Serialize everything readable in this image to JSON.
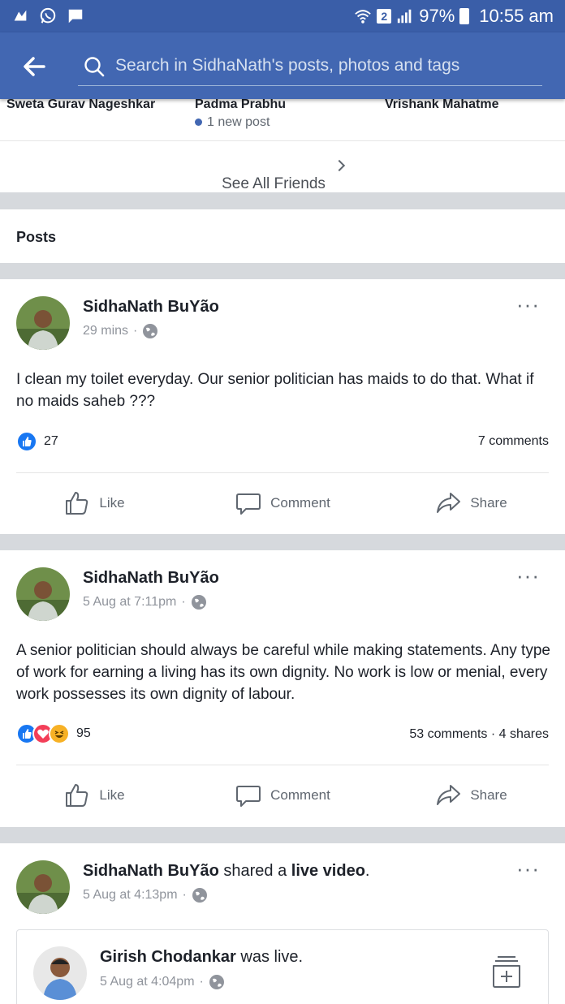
{
  "status_bar": {
    "sim_slot": "2",
    "battery": "97%",
    "time": "10:55 am"
  },
  "search": {
    "placeholder": "Search in SidhaNath's posts, photos and tags"
  },
  "friends": {
    "names": [
      "Sweta Gurav Nageshkar",
      "Padma Prabhu",
      "Vrishank Mahatme"
    ],
    "padma_badge": "1 new post",
    "see_all": "See All Friends"
  },
  "section_title": "Posts",
  "posts": [
    {
      "author": "SidhaNath BuYão",
      "time": "29 mins",
      "text": "I clean my toilet everyday. Our senior politician has maids to do that. What if no maids saheb ???",
      "reaction_count": "27",
      "comments": "7 comments",
      "shares": "",
      "actions": {
        "like": "Like",
        "comment": "Comment",
        "share": "Share"
      }
    },
    {
      "author": "SidhaNath BuYão",
      "time": "5 Aug at 7:11pm",
      "text": "A senior politician should always be careful while making statements. Any type of work for earning a living has its own dignity. No work is low or menial, every work possesses its own dignity of labour.",
      "reaction_count": "95",
      "comments": "53 comments",
      "shares": "4 shares",
      "actions": {
        "like": "Like",
        "comment": "Comment",
        "share": "Share"
      }
    },
    {
      "author": "SidhaNath BuYão",
      "activity_prefix": "shared a",
      "activity_object": "live video",
      "activity_suffix": ".",
      "time": "5 Aug at 4:13pm",
      "shared": {
        "author": "Girish Chodankar",
        "activity": "was live.",
        "time": "5 Aug at 4:04pm"
      }
    }
  ],
  "colors": {
    "facebook_blue": "#4267b2",
    "status_bar": "#3a5ea8",
    "like_blue": "#1877f2",
    "love_red": "#f33e58",
    "haha_yellow": "#f7b125"
  },
  "icons": [
    "back-arrow-icon",
    "search-icon",
    "globe-icon",
    "more-icon",
    "like-icon",
    "comment-icon",
    "share-icon",
    "save-icon"
  ]
}
